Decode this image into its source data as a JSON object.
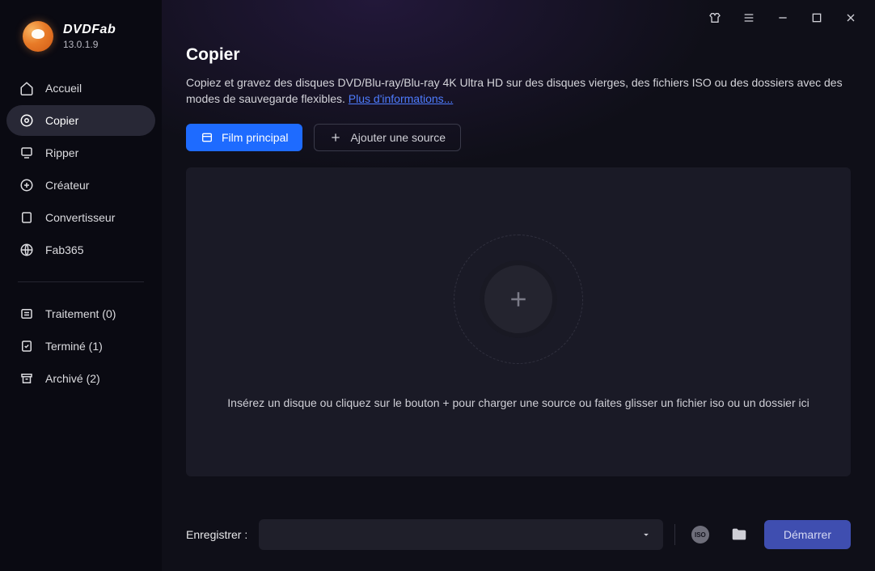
{
  "brand": {
    "name": "DVDFab",
    "version": "13.0.1.9"
  },
  "sidebar": {
    "items": [
      {
        "label": "Accueil"
      },
      {
        "label": "Copier"
      },
      {
        "label": "Ripper"
      },
      {
        "label": "Créateur"
      },
      {
        "label": "Convertisseur"
      },
      {
        "label": "Fab365"
      }
    ],
    "status": [
      {
        "label": "Traitement (0)"
      },
      {
        "label": "Terminé (1)"
      },
      {
        "label": "Archivé (2)"
      }
    ]
  },
  "page": {
    "title": "Copier",
    "description": "Copiez et gravez des disques DVD/Blu-ray/Blu-ray 4K Ultra HD sur des disques vierges, des fichiers ISO ou des dossiers avec des modes de sauvegarde flexibles. ",
    "more_link": "Plus d'informations...",
    "film_button": "Film principal",
    "add_source_button": "Ajouter une source",
    "drop_hint": "Insérez un disque ou cliquez sur le bouton +  pour charger une source ou faites glisser un fichier iso ou un dossier ici"
  },
  "bottom": {
    "save_label": "Enregistrer :",
    "iso_label": "ISO",
    "start_button": "Démarrer"
  }
}
